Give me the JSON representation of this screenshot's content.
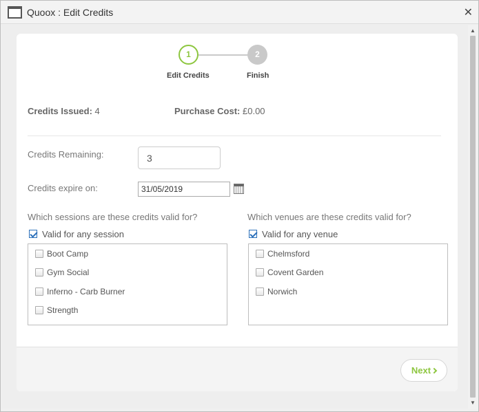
{
  "window": {
    "title": "Quoox : Edit Credits",
    "close_glyph": "✕"
  },
  "steps": [
    {
      "number": "1",
      "label": "Edit Credits",
      "state": "active"
    },
    {
      "number": "2",
      "label": "Finish",
      "state": "inactive"
    }
  ],
  "stats": {
    "issued_label": "Credits Issued:",
    "issued_value": "4",
    "cost_label": "Purchase Cost:",
    "cost_value": "£0.00"
  },
  "form": {
    "remaining_label": "Credits Remaining:",
    "remaining_value": "3",
    "expire_label": "Credits expire on:",
    "expire_value": "31/05/2019"
  },
  "sessions": {
    "question": "Which sessions are these credits valid for?",
    "any_label": "Valid for any session",
    "any_checked": true,
    "items": [
      "Boot Camp",
      "Gym Social",
      "Inferno - Carb Burner",
      "Strength"
    ]
  },
  "venues": {
    "question": "Which venues are these credits valid for?",
    "any_label": "Valid for any venue",
    "any_checked": true,
    "items": [
      "Chelmsford",
      "Covent Garden",
      "Norwich"
    ]
  },
  "footer": {
    "next_label": "Next"
  },
  "colors": {
    "accent": "#8dc63f",
    "checkbox": "#2a6fba",
    "step_inactive": "#c9c9c9"
  },
  "icons": {
    "window": "window-icon",
    "calendar": "calendar-icon",
    "next": "chevron-right-icon"
  }
}
